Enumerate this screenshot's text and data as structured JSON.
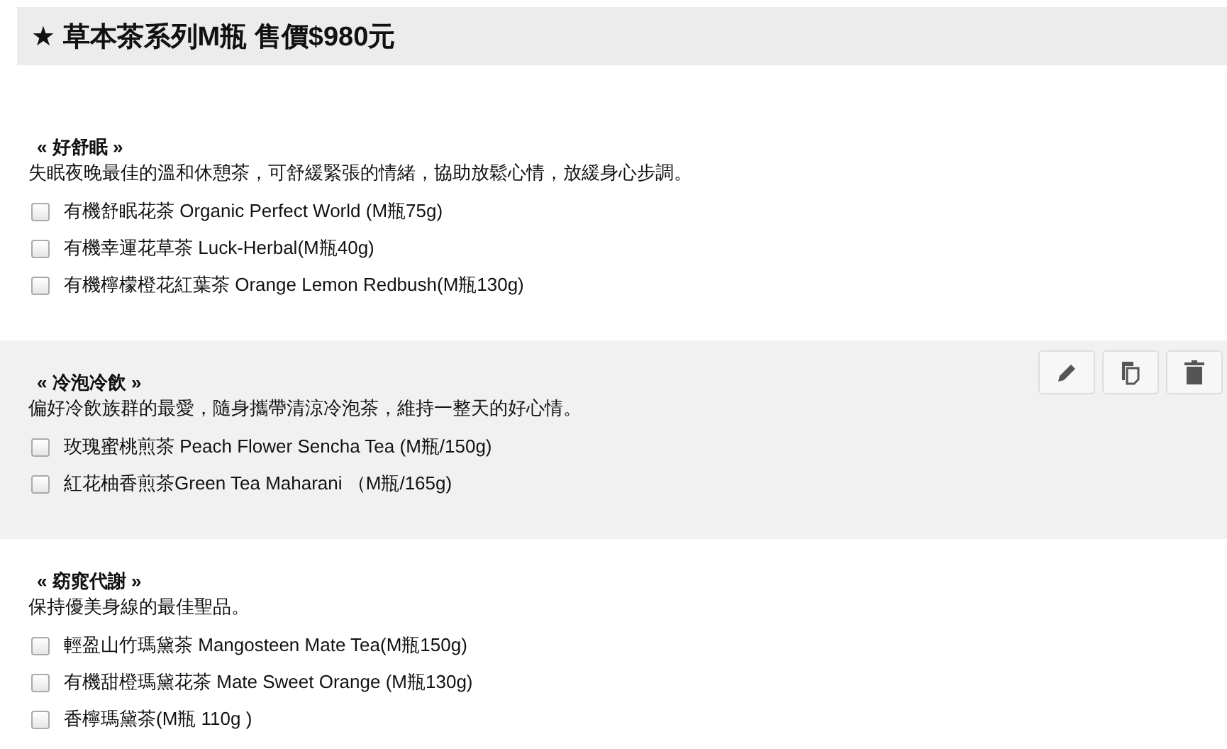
{
  "header": {
    "title": "★ 草本茶系列M瓶 售價$980元"
  },
  "sections": [
    {
      "title": "« 好舒眠 »",
      "description": "失眠夜晚最佳的溫和休憩茶，可舒緩緊張的情緒，協助放鬆心情，放緩身心步調。",
      "highlighted": false,
      "items": [
        {
          "label": "有機舒眠花茶 Organic Perfect World (M瓶75g)",
          "checked": false
        },
        {
          "label": "有機幸運花草茶 Luck-Herbal(M瓶40g)",
          "checked": false
        },
        {
          "label": "有機檸檬橙花紅葉茶 Orange Lemon Redbush(M瓶130g)",
          "checked": false
        }
      ]
    },
    {
      "title": "« 冷泡冷飲 »",
      "description": "偏好冷飲族群的最愛，隨身攜帶清涼冷泡茶，維持一整天的好心情。",
      "highlighted": true,
      "items": [
        {
          "label": "玫瑰蜜桃煎茶 Peach Flower Sencha Tea (M瓶/150g)",
          "checked": false
        },
        {
          "label": "紅花柚香煎茶Green Tea Maharani （M瓶/165g)",
          "checked": false
        }
      ]
    },
    {
      "title": "« 窈窕代謝 »",
      "description": "保持優美身線的最佳聖品。",
      "highlighted": false,
      "items": [
        {
          "label": "輕盈山竹瑪黛茶 Mangosteen Mate Tea(M瓶150g)",
          "checked": false
        },
        {
          "label": "有機甜橙瑪黛花茶 Mate Sweet Orange (M瓶130g)",
          "checked": false
        },
        {
          "label": "香檸瑪黛茶(M瓶 110g )",
          "checked": false
        }
      ]
    }
  ]
}
